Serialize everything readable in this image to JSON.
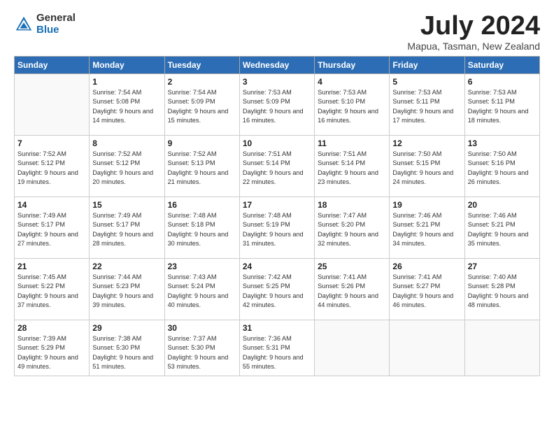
{
  "header": {
    "logo_general": "General",
    "logo_blue": "Blue",
    "month_title": "July 2024",
    "location": "Mapua, Tasman, New Zealand"
  },
  "weekdays": [
    "Sunday",
    "Monday",
    "Tuesday",
    "Wednesday",
    "Thursday",
    "Friday",
    "Saturday"
  ],
  "weeks": [
    [
      {
        "day": "",
        "sunrise": "",
        "sunset": "",
        "daylight": ""
      },
      {
        "day": "1",
        "sunrise": "Sunrise: 7:54 AM",
        "sunset": "Sunset: 5:08 PM",
        "daylight": "Daylight: 9 hours and 14 minutes."
      },
      {
        "day": "2",
        "sunrise": "Sunrise: 7:54 AM",
        "sunset": "Sunset: 5:09 PM",
        "daylight": "Daylight: 9 hours and 15 minutes."
      },
      {
        "day": "3",
        "sunrise": "Sunrise: 7:53 AM",
        "sunset": "Sunset: 5:09 PM",
        "daylight": "Daylight: 9 hours and 16 minutes."
      },
      {
        "day": "4",
        "sunrise": "Sunrise: 7:53 AM",
        "sunset": "Sunset: 5:10 PM",
        "daylight": "Daylight: 9 hours and 16 minutes."
      },
      {
        "day": "5",
        "sunrise": "Sunrise: 7:53 AM",
        "sunset": "Sunset: 5:11 PM",
        "daylight": "Daylight: 9 hours and 17 minutes."
      },
      {
        "day": "6",
        "sunrise": "Sunrise: 7:53 AM",
        "sunset": "Sunset: 5:11 PM",
        "daylight": "Daylight: 9 hours and 18 minutes."
      }
    ],
    [
      {
        "day": "7",
        "sunrise": "Sunrise: 7:52 AM",
        "sunset": "Sunset: 5:12 PM",
        "daylight": "Daylight: 9 hours and 19 minutes."
      },
      {
        "day": "8",
        "sunrise": "Sunrise: 7:52 AM",
        "sunset": "Sunset: 5:12 PM",
        "daylight": "Daylight: 9 hours and 20 minutes."
      },
      {
        "day": "9",
        "sunrise": "Sunrise: 7:52 AM",
        "sunset": "Sunset: 5:13 PM",
        "daylight": "Daylight: 9 hours and 21 minutes."
      },
      {
        "day": "10",
        "sunrise": "Sunrise: 7:51 AM",
        "sunset": "Sunset: 5:14 PM",
        "daylight": "Daylight: 9 hours and 22 minutes."
      },
      {
        "day": "11",
        "sunrise": "Sunrise: 7:51 AM",
        "sunset": "Sunset: 5:14 PM",
        "daylight": "Daylight: 9 hours and 23 minutes."
      },
      {
        "day": "12",
        "sunrise": "Sunrise: 7:50 AM",
        "sunset": "Sunset: 5:15 PM",
        "daylight": "Daylight: 9 hours and 24 minutes."
      },
      {
        "day": "13",
        "sunrise": "Sunrise: 7:50 AM",
        "sunset": "Sunset: 5:16 PM",
        "daylight": "Daylight: 9 hours and 26 minutes."
      }
    ],
    [
      {
        "day": "14",
        "sunrise": "Sunrise: 7:49 AM",
        "sunset": "Sunset: 5:17 PM",
        "daylight": "Daylight: 9 hours and 27 minutes."
      },
      {
        "day": "15",
        "sunrise": "Sunrise: 7:49 AM",
        "sunset": "Sunset: 5:17 PM",
        "daylight": "Daylight: 9 hours and 28 minutes."
      },
      {
        "day": "16",
        "sunrise": "Sunrise: 7:48 AM",
        "sunset": "Sunset: 5:18 PM",
        "daylight": "Daylight: 9 hours and 30 minutes."
      },
      {
        "day": "17",
        "sunrise": "Sunrise: 7:48 AM",
        "sunset": "Sunset: 5:19 PM",
        "daylight": "Daylight: 9 hours and 31 minutes."
      },
      {
        "day": "18",
        "sunrise": "Sunrise: 7:47 AM",
        "sunset": "Sunset: 5:20 PM",
        "daylight": "Daylight: 9 hours and 32 minutes."
      },
      {
        "day": "19",
        "sunrise": "Sunrise: 7:46 AM",
        "sunset": "Sunset: 5:21 PM",
        "daylight": "Daylight: 9 hours and 34 minutes."
      },
      {
        "day": "20",
        "sunrise": "Sunrise: 7:46 AM",
        "sunset": "Sunset: 5:21 PM",
        "daylight": "Daylight: 9 hours and 35 minutes."
      }
    ],
    [
      {
        "day": "21",
        "sunrise": "Sunrise: 7:45 AM",
        "sunset": "Sunset: 5:22 PM",
        "daylight": "Daylight: 9 hours and 37 minutes."
      },
      {
        "day": "22",
        "sunrise": "Sunrise: 7:44 AM",
        "sunset": "Sunset: 5:23 PM",
        "daylight": "Daylight: 9 hours and 39 minutes."
      },
      {
        "day": "23",
        "sunrise": "Sunrise: 7:43 AM",
        "sunset": "Sunset: 5:24 PM",
        "daylight": "Daylight: 9 hours and 40 minutes."
      },
      {
        "day": "24",
        "sunrise": "Sunrise: 7:42 AM",
        "sunset": "Sunset: 5:25 PM",
        "daylight": "Daylight: 9 hours and 42 minutes."
      },
      {
        "day": "25",
        "sunrise": "Sunrise: 7:41 AM",
        "sunset": "Sunset: 5:26 PM",
        "daylight": "Daylight: 9 hours and 44 minutes."
      },
      {
        "day": "26",
        "sunrise": "Sunrise: 7:41 AM",
        "sunset": "Sunset: 5:27 PM",
        "daylight": "Daylight: 9 hours and 46 minutes."
      },
      {
        "day": "27",
        "sunrise": "Sunrise: 7:40 AM",
        "sunset": "Sunset: 5:28 PM",
        "daylight": "Daylight: 9 hours and 48 minutes."
      }
    ],
    [
      {
        "day": "28",
        "sunrise": "Sunrise: 7:39 AM",
        "sunset": "Sunset: 5:29 PM",
        "daylight": "Daylight: 9 hours and 49 minutes."
      },
      {
        "day": "29",
        "sunrise": "Sunrise: 7:38 AM",
        "sunset": "Sunset: 5:30 PM",
        "daylight": "Daylight: 9 hours and 51 minutes."
      },
      {
        "day": "30",
        "sunrise": "Sunrise: 7:37 AM",
        "sunset": "Sunset: 5:30 PM",
        "daylight": "Daylight: 9 hours and 53 minutes."
      },
      {
        "day": "31",
        "sunrise": "Sunrise: 7:36 AM",
        "sunset": "Sunset: 5:31 PM",
        "daylight": "Daylight: 9 hours and 55 minutes."
      },
      {
        "day": "",
        "sunrise": "",
        "sunset": "",
        "daylight": ""
      },
      {
        "day": "",
        "sunrise": "",
        "sunset": "",
        "daylight": ""
      },
      {
        "day": "",
        "sunrise": "",
        "sunset": "",
        "daylight": ""
      }
    ]
  ]
}
